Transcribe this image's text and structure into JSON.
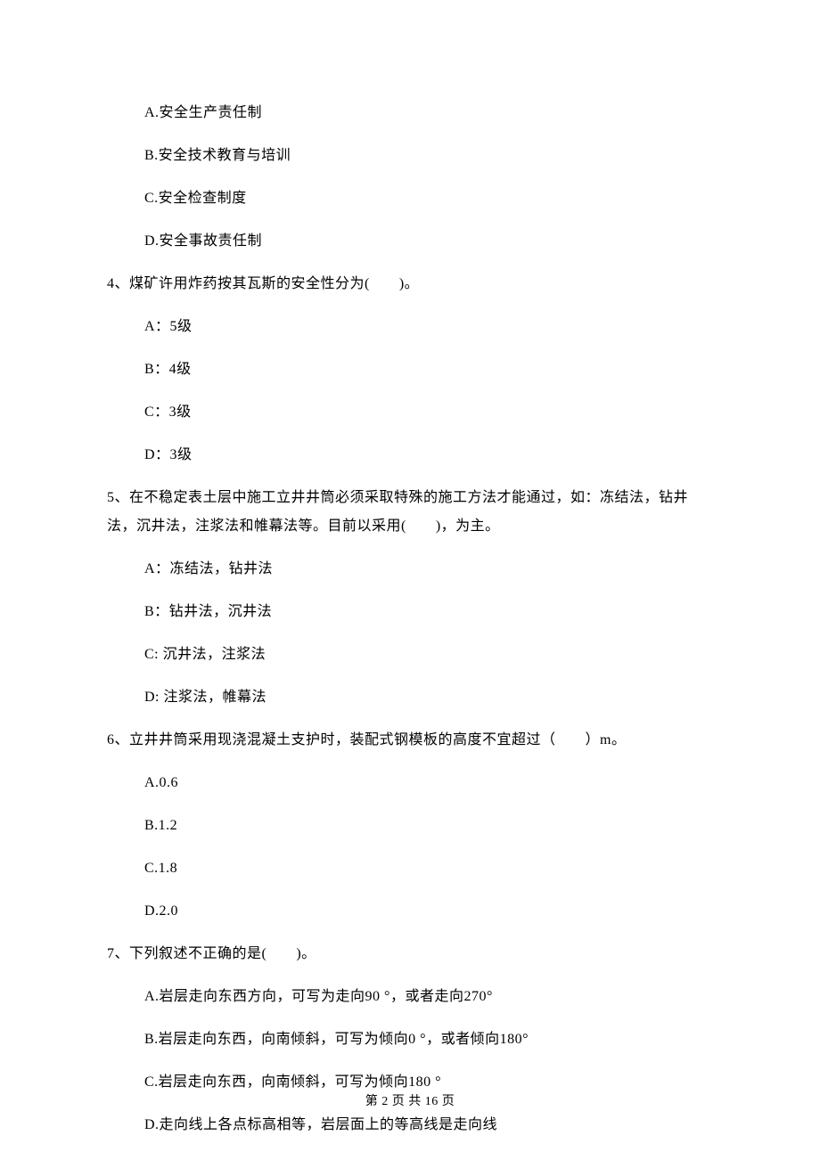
{
  "q3_options": {
    "a": "A.安全生产责任制",
    "b": "B.安全技术教育与培训",
    "c": "C.安全检查制度",
    "d": "D.安全事故责任制"
  },
  "q4": {
    "text": "4、煤矿许用炸药按其瓦斯的安全性分为(　　)。",
    "options": {
      "a": "A：5级",
      "b": "B：4级",
      "c": "C：3级",
      "d": "D：3级"
    }
  },
  "q5": {
    "text_line1": "5、在不稳定表土层中施工立井井筒必须采取特殊的施工方法才能通过，如：冻结法，钻井",
    "text_line2": "法，沉井法，注浆法和帷幕法等。目前以采用(　　)，为主。",
    "options": {
      "a": "A：冻结法，钻井法",
      "b": "B：钻井法，沉井法",
      "c": "C: 沉井法，注浆法",
      "d": "D: 注浆法，帷幕法"
    }
  },
  "q6": {
    "text": "6、立井井筒采用现浇混凝土支护时，装配式钢模板的高度不宜超过（　　）m。",
    "options": {
      "a": "A.0.6",
      "b": "B.1.2",
      "c": "C.1.8",
      "d": "D.2.0"
    }
  },
  "q7": {
    "text": "7、下列叙述不正确的是(　　)。",
    "options": {
      "a": "A.岩层走向东西方向，可写为走向90 °，或者走向270°",
      "b": "B.岩层走向东西，向南倾斜，可写为倾向0 °，或者倾向180°",
      "c": "C.岩层走向东西，向南倾斜，可写为倾向180 °",
      "d": "D.走向线上各点标高相等，岩层面上的等高线是走向线"
    }
  },
  "footer": "第 2 页 共 16 页"
}
